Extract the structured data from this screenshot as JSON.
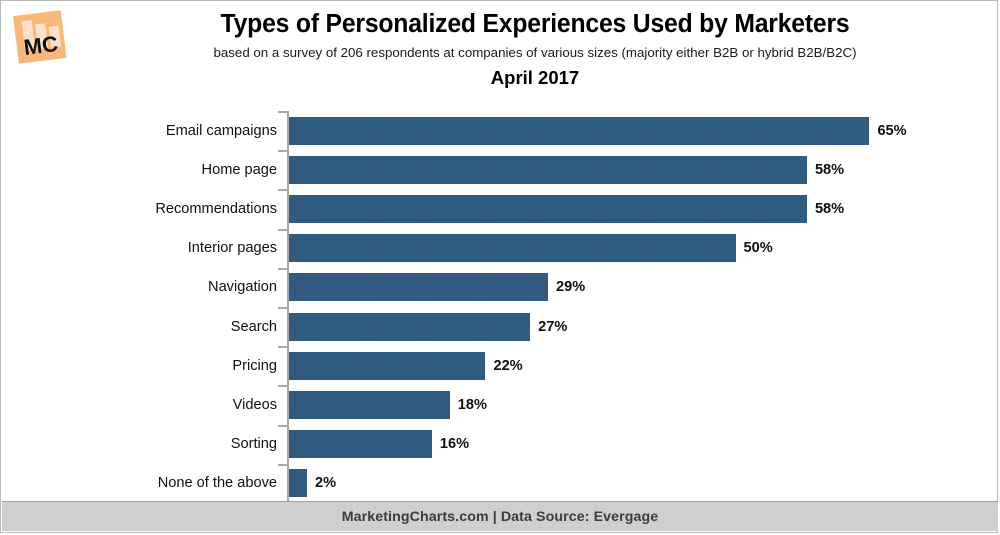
{
  "logo": {
    "text": "MC",
    "bg_color": "#f5b878",
    "bar_color": "#fae0c4",
    "text_color": "#111111"
  },
  "header": {
    "title": "Types of Personalized Experiences Used by Marketers",
    "subtitle": "based on a survey of 206 respondents at companies of various sizes (majority either B2B or hybrid B2B/B2C)",
    "period": "April 2017"
  },
  "footer": {
    "text": "MarketingCharts.com | Data Source: Evergage",
    "site": "MarketingCharts.com",
    "source": "Data Source: Evergage",
    "bar_color": "#cfcfcf"
  },
  "chart_data": {
    "type": "bar",
    "orientation": "horizontal",
    "title": "Types of Personalized Experiences Used by Marketers",
    "subtitle": "based on a survey of 206 respondents at companies of various sizes (majority either B2B or hybrid B2B/B2C)",
    "period": "April 2017",
    "xlabel": "",
    "ylabel": "",
    "xlim": [
      0,
      65
    ],
    "grid": false,
    "legend": null,
    "bar_color": "#2e5b7f",
    "value_suffix": "%",
    "categories": [
      "Email campaigns",
      "Home page",
      "Recommendations",
      "Interior pages",
      "Navigation",
      "Search",
      "Pricing",
      "Videos",
      "Sorting",
      "None of the above"
    ],
    "values": [
      65,
      58,
      58,
      50,
      29,
      27,
      22,
      18,
      16,
      2
    ],
    "labels": [
      "65%",
      "58%",
      "58%",
      "50%",
      "29%",
      "27%",
      "22%",
      "18%",
      "16%",
      "2%"
    ],
    "bars": [
      {
        "category": "Email campaigns",
        "value": 65,
        "label": "65%"
      },
      {
        "category": "Home page",
        "value": 58,
        "label": "58%"
      },
      {
        "category": "Recommendations",
        "value": 58,
        "label": "58%"
      },
      {
        "category": "Interior pages",
        "value": 50,
        "label": "50%"
      },
      {
        "category": "Navigation",
        "value": 29,
        "label": "29%"
      },
      {
        "category": "Search",
        "value": 27,
        "label": "27%"
      },
      {
        "category": "Pricing",
        "value": 22,
        "label": "22%"
      },
      {
        "category": "Videos",
        "value": 18,
        "label": "18%"
      },
      {
        "category": "Sorting",
        "value": 16,
        "label": "16%"
      },
      {
        "category": "None of the above",
        "value": 2,
        "label": "2%"
      }
    ]
  }
}
